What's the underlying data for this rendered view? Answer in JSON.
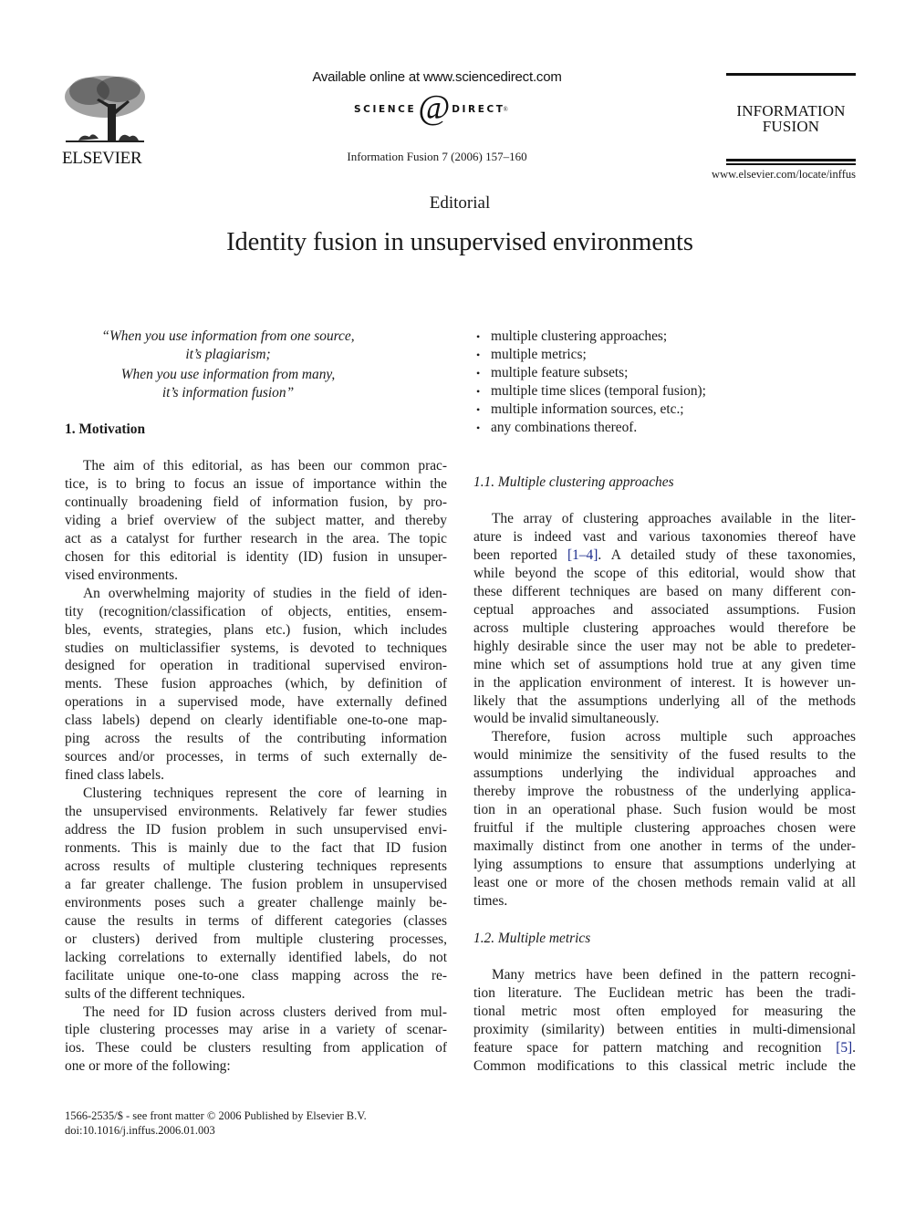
{
  "header": {
    "publisher": "ELSEVIER",
    "available_online": "Available online at www.sciencedirect.com",
    "sciencedirect_left": "SCIENCE",
    "sciencedirect_at": "@",
    "sciencedirect_right": "DIRECT",
    "sciencedirect_tm": "®",
    "journal_reference": "Information Fusion 7 (2006) 157–160",
    "journal_name_line1": "INFORMATION",
    "journal_name_line2": "FUSION",
    "journal_url": "www.elsevier.com/locate/inffus"
  },
  "article": {
    "type": "Editorial",
    "title": "Identity fusion in unsupervised environments"
  },
  "epigraph": [
    "“When you use information from one source,",
    "it’s plagiarism;",
    "When you use information from many,",
    "it’s information fusion”"
  ],
  "left_column": {
    "section_heading": "1. Motivation",
    "paragraphs": [
      {
        "lines": [
          "The aim of this editorial, as has been our common prac-",
          "tice, is to bring to focus an issue of importance within the",
          "continually broadening field of information fusion, by pro-",
          "viding a brief overview of the subject matter, and thereby",
          "act as a catalyst for further research in the area. The topic",
          "chosen for this editorial is identity (ID) fusion in unsuper-",
          "vised environments."
        ]
      },
      {
        "lines": [
          "An overwhelming majority of studies in the field of iden-",
          "tity (recognition/classification of objects, entities, ensem-",
          "bles, events, strategies, plans etc.) fusion, which includes",
          "studies on multiclassifier systems, is devoted to techniques",
          "designed for operation in traditional supervised environ-",
          "ments. These fusion approaches (which, by definition of",
          "operations in a supervised mode, have externally defined",
          "class labels) depend on clearly identifiable one-to-one map-",
          "ping across the results of the contributing information",
          "sources and/or processes, in terms of such externally de-",
          "fined class labels."
        ]
      },
      {
        "lines": [
          "Clustering techniques represent the core of learning in",
          "the unsupervised environments. Relatively far fewer studies",
          "address the ID fusion problem in such unsupervised envi-",
          "ronments. This is mainly due to the fact that ID fusion",
          "across results of multiple clustering techniques represents",
          "a far greater challenge. The fusion problem in unsupervised",
          "environments poses such a greater challenge mainly be-",
          "cause the results in terms of different categories (classes",
          "or clusters) derived from multiple clustering processes,",
          "lacking correlations to externally identified labels, do not",
          "facilitate unique one-to-one class mapping across the re-",
          "sults of the different techniques."
        ]
      },
      {
        "lines": [
          "The need for ID fusion across clusters derived from mul-",
          "tiple clustering processes may arise in a variety of scenar-",
          "ios. These could be clusters resulting from application of",
          "one or more of the following:"
        ]
      }
    ]
  },
  "right_column": {
    "bullets": [
      "multiple clustering approaches;",
      "multiple metrics;",
      "multiple feature subsets;",
      "multiple time slices (temporal fusion);",
      "multiple information sources, etc.;",
      "any combinations thereof."
    ],
    "subsection_1_1": {
      "heading": "1.1.  Multiple clustering approaches",
      "paragraphs": [
        {
          "lines": [
            "The array of clustering approaches available in the liter-",
            "ature is indeed vast and various taxonomies thereof have",
            [
              "been reported ",
              {
                "cite": "[1–4]"
              },
              ". A detailed study of these taxonomies,"
            ],
            "while beyond the scope of this editorial, would show that",
            "these different techniques are based on many different con-",
            "ceptual approaches and associated assumptions. Fusion",
            "across multiple clustering approaches would therefore be",
            "highly desirable since the user may not be able to predeter-",
            "mine which set of assumptions hold true at any given time",
            "in the application environment of interest. It is however un-",
            "likely that the assumptions underlying all of the methods",
            "would be invalid simultaneously."
          ]
        },
        {
          "lines": [
            "Therefore, fusion across multiple such approaches",
            "would minimize the sensitivity of the fused results to the",
            "assumptions underlying the individual approaches and",
            "thereby improve the robustness of the underlying applica-",
            "tion in an operational phase. Such fusion would be most",
            "fruitful if the multiple clustering approaches chosen were",
            "maximally distinct from one another in terms of the under-",
            "lying assumptions to ensure that assumptions underlying at",
            "least one or more of the chosen methods remain valid at all",
            "times."
          ]
        }
      ]
    },
    "subsection_1_2": {
      "heading": "1.2.  Multiple metrics",
      "paragraphs": [
        {
          "lines": [
            "Many metrics have been defined in the pattern recogni-",
            "tion literature. The Euclidean metric has been the tradi-",
            "tional metric most often employed for measuring the",
            "proximity (similarity) between entities in multi-dimensional",
            [
              "feature space for pattern matching and recognition ",
              {
                "cite": "[5]"
              },
              "."
            ],
            "Common modifications to this classical metric include the"
          ],
          "continues": true
        }
      ]
    }
  },
  "footer": {
    "issn_line": "1566-2535/$ - see front matter  © 2006 Published by Elsevier B.V.",
    "doi_line": "doi:10.1016/j.inffus.2006.01.003"
  },
  "colors": {
    "text": "#1a1a1a",
    "citation_link": "#1a2a8c"
  }
}
